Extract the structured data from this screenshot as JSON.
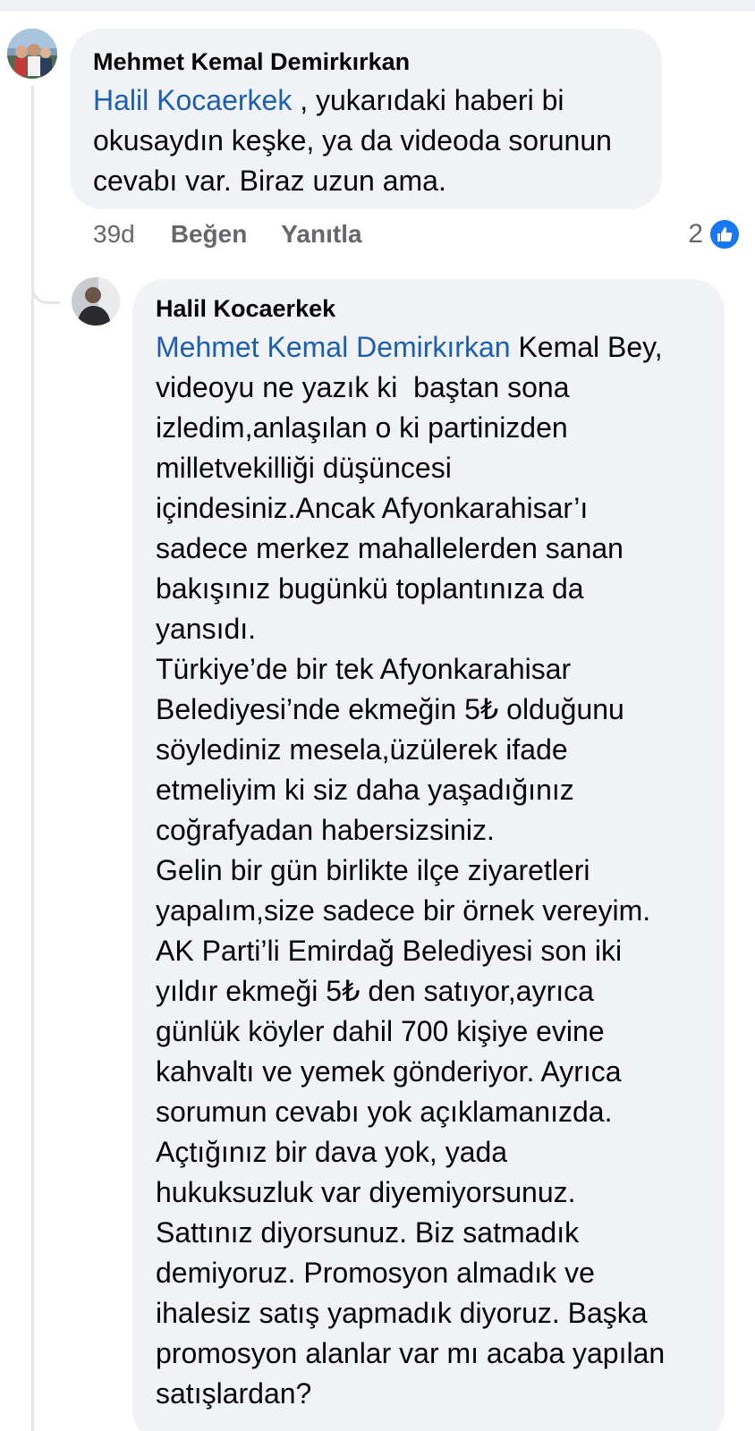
{
  "comment": {
    "author": "Mehmet Kemal Demirkırkan",
    "mention": "Halil Kocaerkek",
    "text_lines": [
      " , yukarıdaki haberi bi",
      "okusaydın keşke, ya da videoda sorunun",
      "cevabı var. Biraz uzun ama."
    ],
    "time": "39d",
    "like_label": "Beğen",
    "reply_label": "Yanıtla",
    "reaction_count": "2",
    "reaction_icon": "thumbs-up-icon",
    "accent_color": "#1877f2"
  },
  "reply": {
    "author": "Halil Kocaerkek",
    "mention": "Mehmet Kemal Demirkırkan",
    "first_line_rest": " Kemal Bey,",
    "lines": [
      "videoyu ne yazık ki  baştan sona",
      "izledim,anlaşılan o ki partinizden",
      "milletvekilliği düşüncesi",
      "içindesiniz.Ancak Afyonkarahisar’ı",
      "sadece merkez mahallelerden sanan",
      "bakışınız bugünkü toplantınıza da",
      "yansıdı.",
      "Türkiye’de bir tek Afyonkarahisar",
      "Belediyesi’nde ekmeğin 5₺ olduğunu",
      "söylediniz mesela,üzülerek ifade",
      "etmeliyim ki siz daha yaşadığınız",
      "coğrafyadan habersizsiniz.",
      "Gelin bir gün birlikte ilçe ziyaretleri",
      "yapalım,size sadece bir örnek vereyim.",
      "AK Parti’li Emirdağ Belediyesi son iki",
      "yıldır ekmeği 5₺ den satıyor,ayrıca",
      "günlük köyler dahil 700 kişiye evine",
      "kahvaltı ve yemek gönderiyor. Ayrıca",
      "sorumun cevabı yok açıklamanızda.",
      "Açtığınız bir dava yok, yada",
      "hukuksuzluk var diyemiyorsunuz.",
      "Sattınız diyorsunuz. Biz satmadık",
      "demiyoruz. Promosyon almadık ve",
      "ihalesiz satış yapmadık diyoruz. Başka",
      "promosyon alanlar var mı acaba yapılan",
      "satışlardan?"
    ]
  }
}
